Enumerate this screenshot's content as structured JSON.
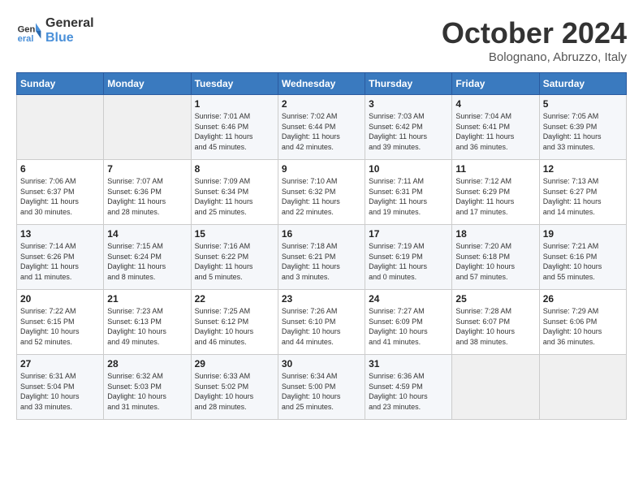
{
  "logo": {
    "line1": "General",
    "line2": "Blue"
  },
  "title": "October 2024",
  "subtitle": "Bolognano, Abruzzo, Italy",
  "weekdays": [
    "Sunday",
    "Monday",
    "Tuesday",
    "Wednesday",
    "Thursday",
    "Friday",
    "Saturday"
  ],
  "weeks": [
    [
      {
        "day": "",
        "info": ""
      },
      {
        "day": "",
        "info": ""
      },
      {
        "day": "1",
        "info": "Sunrise: 7:01 AM\nSunset: 6:46 PM\nDaylight: 11 hours\nand 45 minutes."
      },
      {
        "day": "2",
        "info": "Sunrise: 7:02 AM\nSunset: 6:44 PM\nDaylight: 11 hours\nand 42 minutes."
      },
      {
        "day": "3",
        "info": "Sunrise: 7:03 AM\nSunset: 6:42 PM\nDaylight: 11 hours\nand 39 minutes."
      },
      {
        "day": "4",
        "info": "Sunrise: 7:04 AM\nSunset: 6:41 PM\nDaylight: 11 hours\nand 36 minutes."
      },
      {
        "day": "5",
        "info": "Sunrise: 7:05 AM\nSunset: 6:39 PM\nDaylight: 11 hours\nand 33 minutes."
      }
    ],
    [
      {
        "day": "6",
        "info": "Sunrise: 7:06 AM\nSunset: 6:37 PM\nDaylight: 11 hours\nand 30 minutes."
      },
      {
        "day": "7",
        "info": "Sunrise: 7:07 AM\nSunset: 6:36 PM\nDaylight: 11 hours\nand 28 minutes."
      },
      {
        "day": "8",
        "info": "Sunrise: 7:09 AM\nSunset: 6:34 PM\nDaylight: 11 hours\nand 25 minutes."
      },
      {
        "day": "9",
        "info": "Sunrise: 7:10 AM\nSunset: 6:32 PM\nDaylight: 11 hours\nand 22 minutes."
      },
      {
        "day": "10",
        "info": "Sunrise: 7:11 AM\nSunset: 6:31 PM\nDaylight: 11 hours\nand 19 minutes."
      },
      {
        "day": "11",
        "info": "Sunrise: 7:12 AM\nSunset: 6:29 PM\nDaylight: 11 hours\nand 17 minutes."
      },
      {
        "day": "12",
        "info": "Sunrise: 7:13 AM\nSunset: 6:27 PM\nDaylight: 11 hours\nand 14 minutes."
      }
    ],
    [
      {
        "day": "13",
        "info": "Sunrise: 7:14 AM\nSunset: 6:26 PM\nDaylight: 11 hours\nand 11 minutes."
      },
      {
        "day": "14",
        "info": "Sunrise: 7:15 AM\nSunset: 6:24 PM\nDaylight: 11 hours\nand 8 minutes."
      },
      {
        "day": "15",
        "info": "Sunrise: 7:16 AM\nSunset: 6:22 PM\nDaylight: 11 hours\nand 5 minutes."
      },
      {
        "day": "16",
        "info": "Sunrise: 7:18 AM\nSunset: 6:21 PM\nDaylight: 11 hours\nand 3 minutes."
      },
      {
        "day": "17",
        "info": "Sunrise: 7:19 AM\nSunset: 6:19 PM\nDaylight: 11 hours\nand 0 minutes."
      },
      {
        "day": "18",
        "info": "Sunrise: 7:20 AM\nSunset: 6:18 PM\nDaylight: 10 hours\nand 57 minutes."
      },
      {
        "day": "19",
        "info": "Sunrise: 7:21 AM\nSunset: 6:16 PM\nDaylight: 10 hours\nand 55 minutes."
      }
    ],
    [
      {
        "day": "20",
        "info": "Sunrise: 7:22 AM\nSunset: 6:15 PM\nDaylight: 10 hours\nand 52 minutes."
      },
      {
        "day": "21",
        "info": "Sunrise: 7:23 AM\nSunset: 6:13 PM\nDaylight: 10 hours\nand 49 minutes."
      },
      {
        "day": "22",
        "info": "Sunrise: 7:25 AM\nSunset: 6:12 PM\nDaylight: 10 hours\nand 46 minutes."
      },
      {
        "day": "23",
        "info": "Sunrise: 7:26 AM\nSunset: 6:10 PM\nDaylight: 10 hours\nand 44 minutes."
      },
      {
        "day": "24",
        "info": "Sunrise: 7:27 AM\nSunset: 6:09 PM\nDaylight: 10 hours\nand 41 minutes."
      },
      {
        "day": "25",
        "info": "Sunrise: 7:28 AM\nSunset: 6:07 PM\nDaylight: 10 hours\nand 38 minutes."
      },
      {
        "day": "26",
        "info": "Sunrise: 7:29 AM\nSunset: 6:06 PM\nDaylight: 10 hours\nand 36 minutes."
      }
    ],
    [
      {
        "day": "27",
        "info": "Sunrise: 6:31 AM\nSunset: 5:04 PM\nDaylight: 10 hours\nand 33 minutes."
      },
      {
        "day": "28",
        "info": "Sunrise: 6:32 AM\nSunset: 5:03 PM\nDaylight: 10 hours\nand 31 minutes."
      },
      {
        "day": "29",
        "info": "Sunrise: 6:33 AM\nSunset: 5:02 PM\nDaylight: 10 hours\nand 28 minutes."
      },
      {
        "day": "30",
        "info": "Sunrise: 6:34 AM\nSunset: 5:00 PM\nDaylight: 10 hours\nand 25 minutes."
      },
      {
        "day": "31",
        "info": "Sunrise: 6:36 AM\nSunset: 4:59 PM\nDaylight: 10 hours\nand 23 minutes."
      },
      {
        "day": "",
        "info": ""
      },
      {
        "day": "",
        "info": ""
      }
    ]
  ]
}
